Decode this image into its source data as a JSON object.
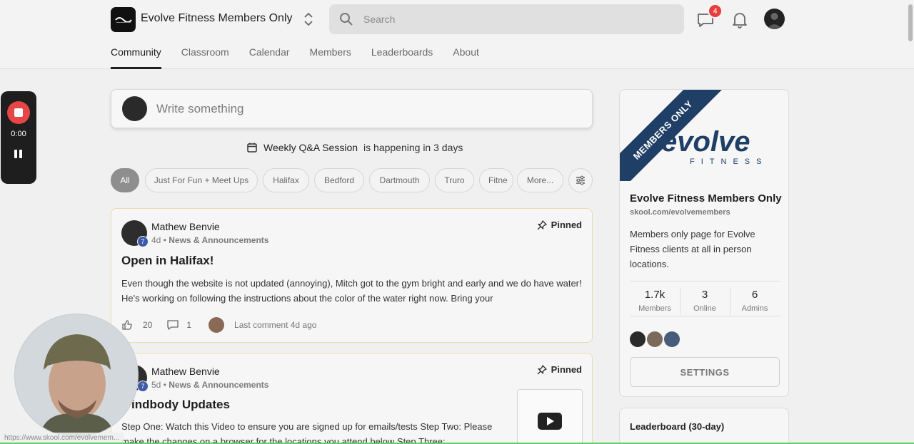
{
  "header": {
    "group_name": "Evolve Fitness Members Only",
    "search_placeholder": "Search",
    "chat_badge": "4",
    "tabs": [
      {
        "label": "Community",
        "active": true
      },
      {
        "label": "Classroom"
      },
      {
        "label": "Calendar"
      },
      {
        "label": "Members"
      },
      {
        "label": "Leaderboards"
      },
      {
        "label": "About"
      }
    ]
  },
  "recorder": {
    "time": "0:00"
  },
  "composer": {
    "placeholder": "Write something"
  },
  "event": {
    "name": "Weekly Q&A Session",
    "suffix": "is happening in 3 days"
  },
  "chips": [
    "All",
    "Just For Fun + Meet Ups",
    "Halifax",
    "Bedford",
    "Dartmouth",
    "Truro",
    "Fitne",
    "More..."
  ],
  "posts": [
    {
      "author": "Mathew Benvie",
      "level": "7",
      "time": "4d",
      "category": "News & Announcements",
      "pinned_label": "Pinned",
      "title": "Open in Halifax!",
      "body": "Even though the website is not updated (annoying), Mitch got to the gym bright and early and we do have water! He's working on following the instructions about the color of the water right now. Bring your",
      "likes": "20",
      "comments": "1",
      "last_comment": "Last comment 4d ago"
    },
    {
      "author": "Mathew Benvie",
      "level": "7",
      "time": "5d",
      "category": "News & Announcements",
      "pinned_label": "Pinned",
      "title": "indbody Updates",
      "body": "Step One: Watch this Video to ensure you are signed up for emails/tests Step Two: Please make the changes on a browser for the locations you attend below Step Three:"
    }
  ],
  "sidebar": {
    "ribbon": "MEMBERS ONLY",
    "brand_word": "evolve",
    "brand_sub": "FITNESS",
    "name": "Evolve Fitness Members Only",
    "url": "skool.com/evolvemembers",
    "description": "Members only page for Evolve Fitness clients at all in person locations.",
    "stats": [
      {
        "value": "1.7k",
        "label": "Members"
      },
      {
        "value": "3",
        "label": "Online"
      },
      {
        "value": "6",
        "label": "Admins"
      }
    ],
    "settings_label": "SETTINGS",
    "leaderboard_title": "Leaderboard (30-day)"
  },
  "status_url": "https://www.skool.com/evolvemem...",
  "colors": {
    "accent_badge": "#e63e3e",
    "level": "#3d5ba9",
    "ribbon": "#1f3f66",
    "record": "#e64646"
  }
}
